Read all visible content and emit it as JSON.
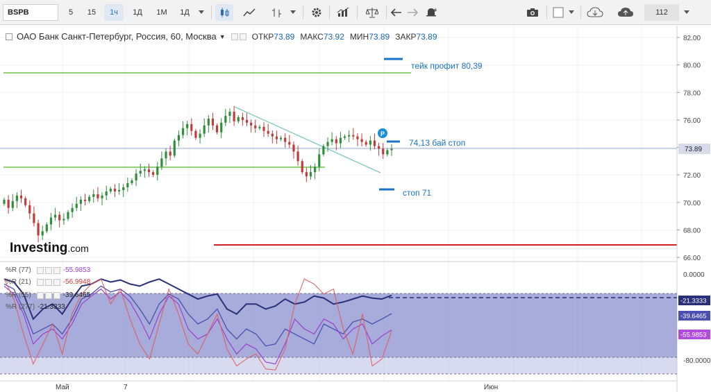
{
  "toolbar": {
    "symbol": "BSPB",
    "intervals": [
      "5",
      "15",
      "1ч",
      "1Д",
      "1М",
      "1Д"
    ],
    "active_interval": "1ч",
    "zoom": "112"
  },
  "legend": {
    "title": "ОАО Банк Санкт-Петербург, Россия, 60, Москва",
    "open_label": "ОТКР",
    "open": "73.89",
    "high_label": "МАКС",
    "high": "73.92",
    "low_label": "МИН",
    "low": "73.89",
    "close_label": "ЗАКР",
    "close": "73.89"
  },
  "watermark": {
    "brand": "Investing",
    "suffix": ".com"
  },
  "annotations": {
    "take_profit": "тейк профит 80,39",
    "buy_stop": "74,13 бай стоп",
    "stop": "стоп 71",
    "marker": "P"
  },
  "price_axis": {
    "ticks": [
      "82.00",
      "80.00",
      "78.00",
      "76.00",
      "74.00",
      "72.00",
      "70.00",
      "68.00",
      "66.00"
    ],
    "current": "73.89"
  },
  "williams_axis": {
    "ticks": [
      "0.0000",
      "-80.0000"
    ],
    "badges": [
      "-21.3333",
      "-39.6465",
      "-55.9853"
    ]
  },
  "indicators": [
    {
      "label": "%R (77)",
      "value": "-55.9853",
      "color": "#9b3fd0"
    },
    {
      "label": "%R (21)",
      "value": "-56.9948",
      "color": "#d63a3a"
    },
    {
      "label": "%R (55)",
      "value": "-39.6465",
      "color": "#4a4fb0"
    },
    {
      "label": "%R (277)",
      "value": "-21.3333",
      "color": "#2a2f7a"
    }
  ],
  "time_axis": {
    "labels": [
      "Май",
      "7",
      "Июн"
    ]
  },
  "colors": {
    "up": "#2f8f3a",
    "down": "#c23b3b",
    "green_line": "#6cc04a",
    "red_line": "#d21f1f",
    "blue_level": "#1a73c8",
    "fill": "#8e95cf"
  },
  "chart_data": {
    "type": "candlestick",
    "y_unit": "price",
    "ylim": [
      65.5,
      82.5
    ],
    "horizontal_levels": [
      {
        "price": 79.35,
        "color": "green"
      },
      {
        "price": 72.6,
        "color": "green"
      },
      {
        "price": 67.0,
        "color": "red"
      },
      {
        "price": 73.89,
        "color": "current"
      }
    ],
    "trade_levels": [
      {
        "price": 80.39,
        "label": "тейк профит 80,39"
      },
      {
        "price": 74.13,
        "label": "74,13 бай стоп"
      },
      {
        "price": 71.0,
        "label": "стоп 71"
      }
    ],
    "closes": [
      70.2,
      69.6,
      70.1,
      70.5,
      70.3,
      69.8,
      69.2,
      68.5,
      67.6,
      67.9,
      68.4,
      68.9,
      69.1,
      68.7,
      68.8,
      69.3,
      69.6,
      69.9,
      70.2,
      70.1,
      70.4,
      70.6,
      70.3,
      70.5,
      70.8,
      71.0,
      70.8,
      70.9,
      71.1,
      71.4,
      71.6,
      72.1,
      72.3,
      72.4,
      72.2,
      72.0,
      72.6,
      73.2,
      73.7,
      73.4,
      74.5,
      74.9,
      75.4,
      75.7,
      75.2,
      74.7,
      75.0,
      75.6,
      76.1,
      75.6,
      75.1,
      75.8,
      76.3,
      76.6,
      75.9,
      76.2,
      76.0,
      75.8,
      75.6,
      75.4,
      75.5,
      75.2,
      75.0,
      74.8,
      74.6,
      74.7,
      74.4,
      74.2,
      73.7,
      73.0,
      72.2,
      71.9,
      72.2,
      72.6,
      73.5,
      74.1,
      74.4,
      74.6,
      74.3,
      74.7,
      74.8,
      74.9,
      74.8,
      74.6,
      74.4,
      74.2,
      74.5,
      74.1,
      73.9,
      73.5,
      73.8,
      73.9
    ],
    "williams_r": [
      {
        "name": "%R (77)",
        "last": -55.9853
      },
      {
        "name": "%R (21)",
        "last": -56.9948
      },
      {
        "name": "%R (55)",
        "last": -39.6465
      },
      {
        "name": "%R (277)",
        "last": -21.3333
      }
    ]
  }
}
